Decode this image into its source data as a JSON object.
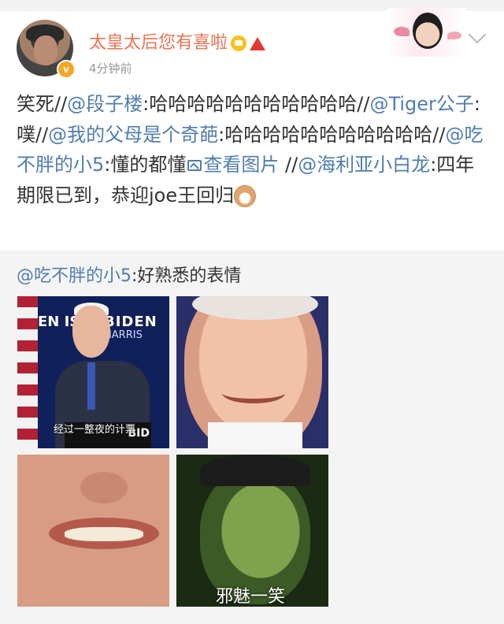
{
  "post": {
    "username": "太皇太后您有喜啦",
    "timestamp": "4分钟前",
    "body": {
      "t1": "笑死//",
      "a1": "@段子楼",
      "t2": ":哈哈哈哈哈哈哈哈哈哈哈//",
      "a2": "@Tiger公子",
      "t3": ":噗//",
      "a3": "@我的父母是个奇葩",
      "t4": ":哈哈哈哈哈哈哈哈哈哈哈//",
      "a4": "@吃不胖的小5",
      "t5": ":懂的都懂",
      "link": "查看图片",
      "t6": " //",
      "a5": "@海利亚小白龙",
      "t7": ":四年期限已到，恭迎joe王回归"
    }
  },
  "repost": {
    "mention": "@吃不胖的小5",
    "text": ":好熟悉的表情",
    "images": [
      {
        "caption": "经过一整夜的计票",
        "sign_left": "EN IS",
        "sign_right": "BIDEN",
        "sign_right2": "HARRIS",
        "podium": "BID"
      },
      {
        "caption": ""
      },
      {
        "caption": ""
      },
      {
        "caption": "邪魅一笑"
      }
    ]
  },
  "icons": {
    "verified": "verified-badge-icon",
    "vip": "vip-crown-icon",
    "red": "red-a-icon",
    "chevron": "chevron-down-icon",
    "image_link": "image-link-icon",
    "emoji": "cat-emoji-icon"
  },
  "colors": {
    "username": "#eb7350",
    "mention": "#507daf",
    "repost_bg": "#f4f4f4"
  }
}
